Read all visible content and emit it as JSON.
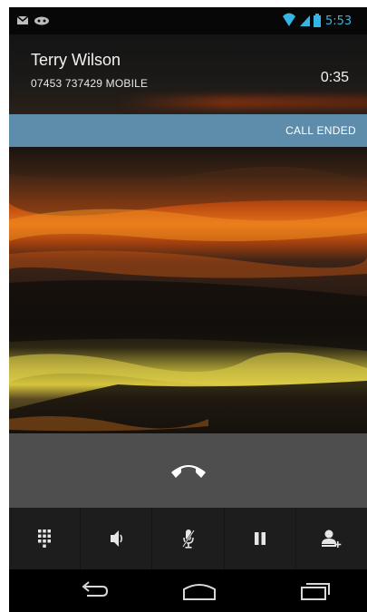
{
  "status_bar": {
    "time": "5:53",
    "notification_icons": [
      "gmail-icon",
      "voicemail-icon"
    ],
    "system_icons": [
      "wifi-icon",
      "signal-icon",
      "battery-icon"
    ]
  },
  "caller": {
    "name": "Terry Wilson",
    "number_label": "07453 737429  MOBILE",
    "elapsed": "0:35"
  },
  "call_state": "CALL ENDED",
  "end_call": {
    "icon": "end-call-icon"
  },
  "controls": [
    {
      "id": "dialpad",
      "icon": "dialpad-icon"
    },
    {
      "id": "speaker",
      "icon": "speaker-icon"
    },
    {
      "id": "mute",
      "icon": "mute-icon"
    },
    {
      "id": "hold",
      "icon": "pause-icon"
    },
    {
      "id": "add-call",
      "icon": "add-call-icon"
    }
  ],
  "nav": [
    "back-icon",
    "home-icon",
    "recents-icon"
  ],
  "colors": {
    "call_state_bar": "#5e8dab",
    "end_call_area": "#4e4e4e",
    "controls_bar": "#1d1d1d",
    "end_call_icon": "#ffffff"
  }
}
